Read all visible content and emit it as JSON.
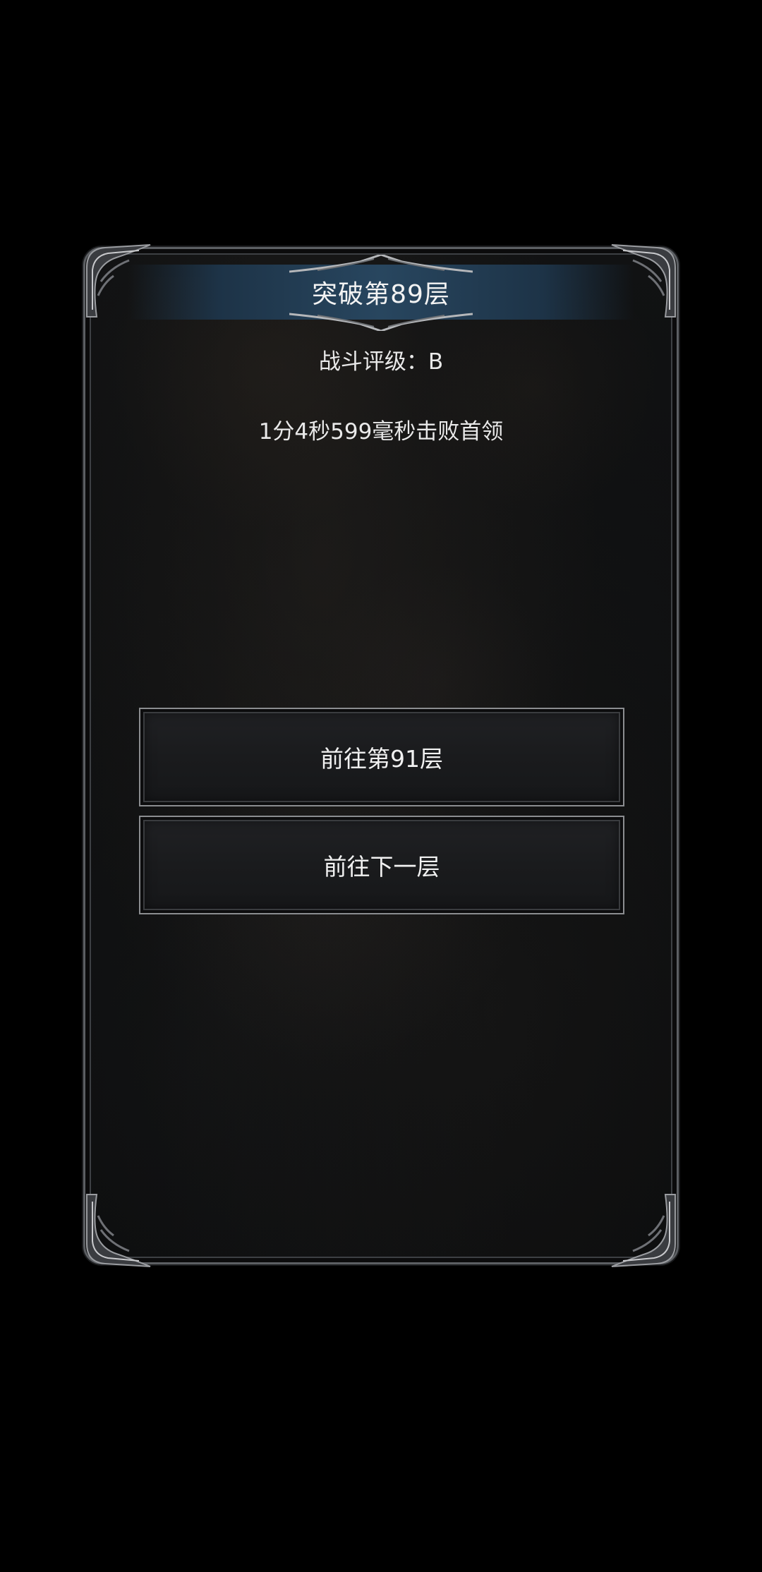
{
  "dialog": {
    "title": "突破第89层",
    "rating_text": "战斗评级：B",
    "defeat_time_text": "1分4秒599毫秒击败首领"
  },
  "buttons": {
    "goto_floor_91": "前往第91层",
    "goto_next_floor": "前往下一层"
  },
  "colors": {
    "background": "#000000",
    "banner": "#28465f",
    "frame": "#5c5f63",
    "text": "#f3f3f3"
  }
}
